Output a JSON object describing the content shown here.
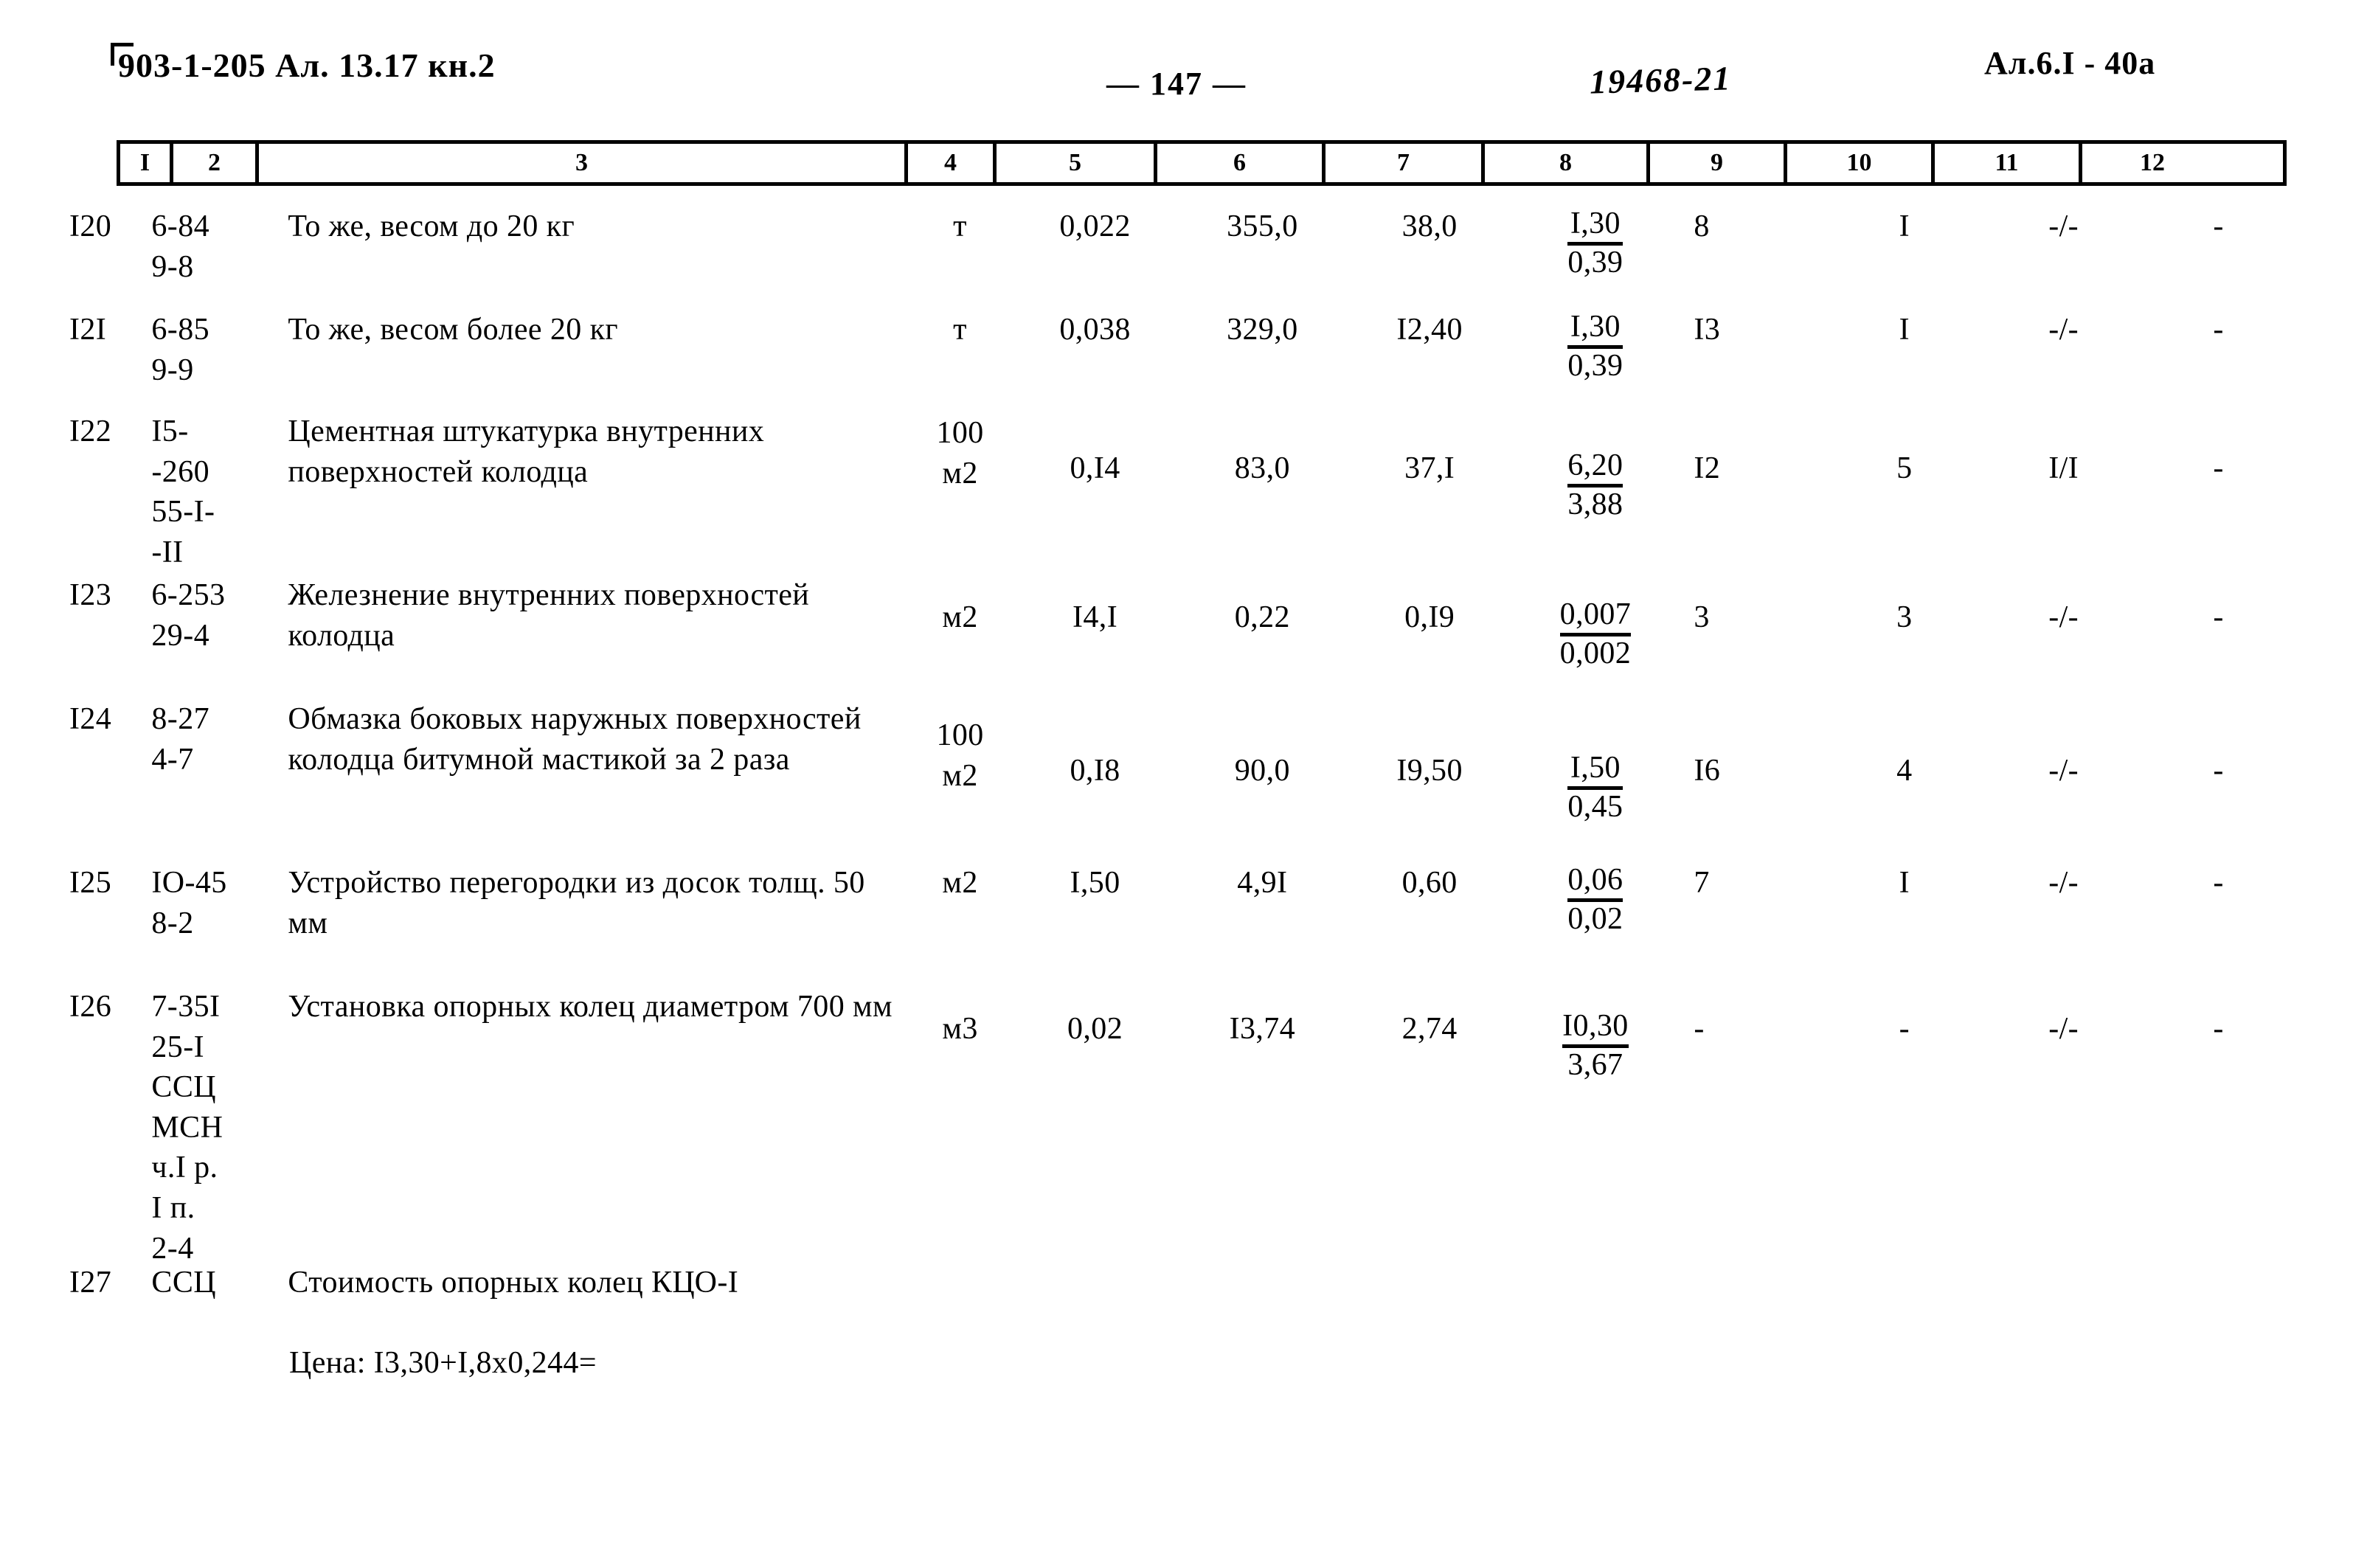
{
  "header": {
    "doc_code": "903-1-205 Ал. 13.17 кн.2",
    "page_number": "— 147 —",
    "stamp_number": "19468-21",
    "album_ref": "Ал.6.I - 40а"
  },
  "table": {
    "column_numbers": [
      "I",
      "2",
      "3",
      "4",
      "5",
      "6",
      "7",
      "8",
      "9",
      "10",
      "11",
      "12"
    ],
    "rows": [
      {
        "pos": "I20",
        "code": "6-84\n9-8",
        "name": "То же, весом до 20 кг",
        "unit": "т",
        "c5": "0,022",
        "c6": "355,0",
        "c7": "38,0",
        "c8_top": "I,30",
        "c8_bot": "0,39",
        "c9": "8",
        "c10": "I",
        "c11": "-/-",
        "c12": "-"
      },
      {
        "pos": "I2I",
        "code": "6-85\n9-9",
        "name": "То же, весом более 20 кг",
        "unit": "т",
        "c5": "0,038",
        "c6": "329,0",
        "c7": "I2,40",
        "c8_top": "I,30",
        "c8_bot": "0,39",
        "c9": "I3",
        "c10": "I",
        "c11": "-/-",
        "c12": "-"
      },
      {
        "pos": "I22",
        "code": "I5-\n-260\n55-I-\n-II",
        "name": "Цементная штукатурка внутренних поверхностей колодца",
        "unit": "100\nм2",
        "c5": "0,I4",
        "c6": "83,0",
        "c7": "37,I",
        "c8_top": "6,20",
        "c8_bot": "3,88",
        "c9": "I2",
        "c10": "5",
        "c11": "I/I",
        "c12": "-"
      },
      {
        "pos": "I23",
        "code": "6-253\n29-4",
        "name": "Железнение внутренних поверхностей колодца",
        "unit": "м2",
        "c5": "I4,I",
        "c6": "0,22",
        "c7": "0,I9",
        "c8_top": "0,007",
        "c8_bot": "0,002",
        "c9": "3",
        "c10": "3",
        "c11": "-/-",
        "c12": "-"
      },
      {
        "pos": "I24",
        "code": "8-27\n4-7",
        "name": "Обмазка боковых наружных поверхностей колодца битумной мастикой за 2 раза",
        "unit": "100\nм2",
        "c5": "0,I8",
        "c6": "90,0",
        "c7": "I9,50",
        "c8_top": "I,50",
        "c8_bot": "0,45",
        "c9": "I6",
        "c10": "4",
        "c11": "-/-",
        "c12": "-"
      },
      {
        "pos": "I25",
        "code": "IO-45\n8-2",
        "name": "Устройство перегородки из досок толщ. 50 мм",
        "unit": "м2",
        "c5": "I,50",
        "c6": "4,9I",
        "c7": "0,60",
        "c8_top": "0,06",
        "c8_bot": "0,02",
        "c9": "7",
        "c10": "I",
        "c11": "-/-",
        "c12": "-"
      },
      {
        "pos": "I26",
        "code": "7-35I\n25-I\nССЦ\nМСН\nч.I р.\nI п.\n2-4",
        "name": "Установка опорных колец диаметром 700 мм",
        "unit": "м3",
        "c5": "0,02",
        "c6": "I3,74",
        "c7": "2,74",
        "c8_top": "I0,30",
        "c8_bot": "3,67",
        "c9": "-",
        "c10": "-",
        "c11": "-/-",
        "c12": "-"
      },
      {
        "pos": "I27",
        "code": "ССЦ",
        "name": "Стоимость опорных колец КЦО-I",
        "unit": "",
        "c5": "",
        "c6": "",
        "c7": "",
        "c8_top": "",
        "c8_bot": "",
        "c9": "",
        "c10": "",
        "c11": "",
        "c12": ""
      }
    ],
    "price_note": "Цена: I3,30+I,8х0,244="
  }
}
